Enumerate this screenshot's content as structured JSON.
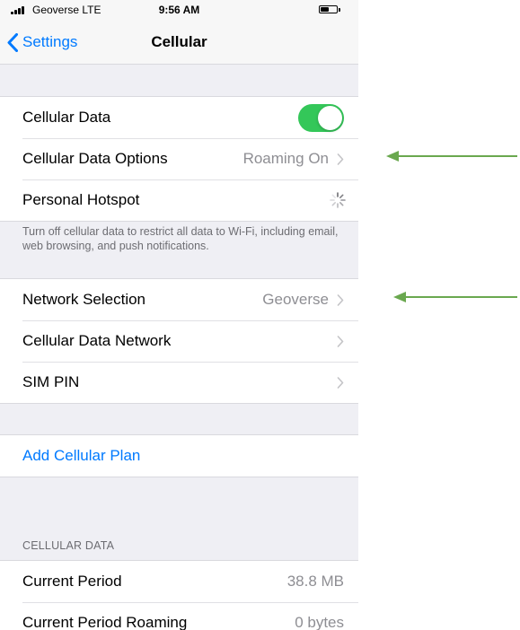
{
  "status_bar": {
    "carrier": "Geoverse LTE",
    "time": "9:56 AM",
    "battery_level": 0.5
  },
  "nav": {
    "back_label": "Settings",
    "title": "Cellular"
  },
  "group1": {
    "rows": [
      {
        "label": "Cellular Data",
        "toggle_on": true
      },
      {
        "label": "Cellular Data Options",
        "value": "Roaming On"
      },
      {
        "label": "Personal Hotspot",
        "status": "loading-spinner-icon"
      }
    ],
    "footer": "Turn off cellular data to restrict all data to Wi-Fi, including email, web browsing, and push notifications."
  },
  "group2": {
    "rows": [
      {
        "label": "Network Selection",
        "value": "Geoverse"
      },
      {
        "label": "Cellular Data Network",
        "value": ""
      },
      {
        "label": "SIM PIN",
        "value": ""
      }
    ]
  },
  "group3": {
    "add_plan_label": "Add Cellular Plan"
  },
  "cellular_data_section": {
    "header": "CELLULAR DATA",
    "rows": [
      {
        "label": "Current Period",
        "value": "38.8 MB"
      },
      {
        "label": "Current Period Roaming",
        "value": "0 bytes"
      }
    ]
  },
  "colors": {
    "accent": "#007aff",
    "toggle_on": "#34c759",
    "annotation_arrow": "#6aa84f"
  },
  "annotations": [
    {
      "icon": "arrow-left-icon",
      "points_to": "Cellular Data Options"
    },
    {
      "icon": "arrow-left-icon",
      "points_to": "Network Selection"
    }
  ]
}
